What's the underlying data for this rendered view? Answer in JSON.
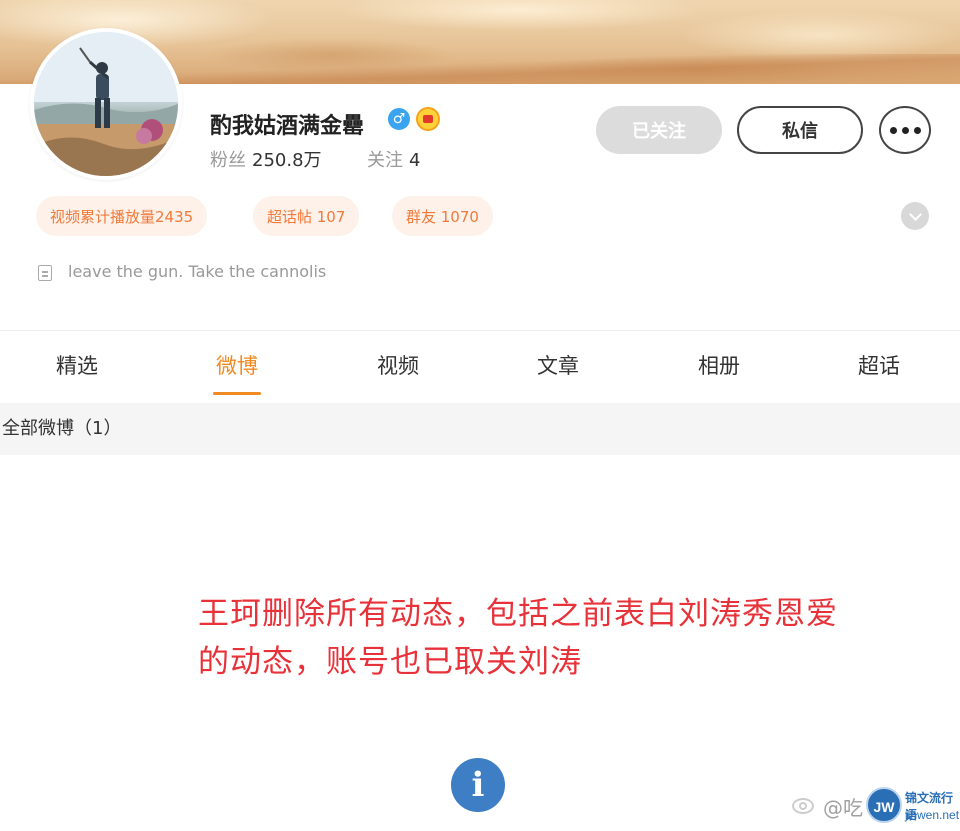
{
  "profile": {
    "username": "酌我姑酒满金罍",
    "gender_badge": "♂",
    "stats": {
      "fans_label": "粉丝",
      "fans_value": "250.8万",
      "following_label": "关注",
      "following_value": "4"
    },
    "buttons": {
      "followed": "已关注",
      "message": "私信"
    },
    "tags": [
      "视频累计播放量2435",
      "超话帖 107",
      "群友 1070"
    ],
    "bio": "leave the gun. Take the cannolis"
  },
  "tabs": [
    "精选",
    "微博",
    "视频",
    "文章",
    "相册",
    "超话"
  ],
  "active_tab": "微博",
  "filter": {
    "label": "全部微博（1）"
  },
  "annotation": {
    "line1": "王珂删除所有动态，包括之前表白刘涛秀恩爱",
    "line2": "的动态，账号也已取关刘涛"
  },
  "info_glyph": "i",
  "watermark": {
    "handle": "@吃",
    "logo_text": "JW",
    "title": "锦文流行语",
    "url": "jinwen.net"
  },
  "colors": {
    "accent_orange": "#f08a22",
    "tag_text": "#f07a3a",
    "annotation_red": "#e8323a",
    "info_blue": "#3d7ec4",
    "verified_blue": "#3ba4f0"
  }
}
